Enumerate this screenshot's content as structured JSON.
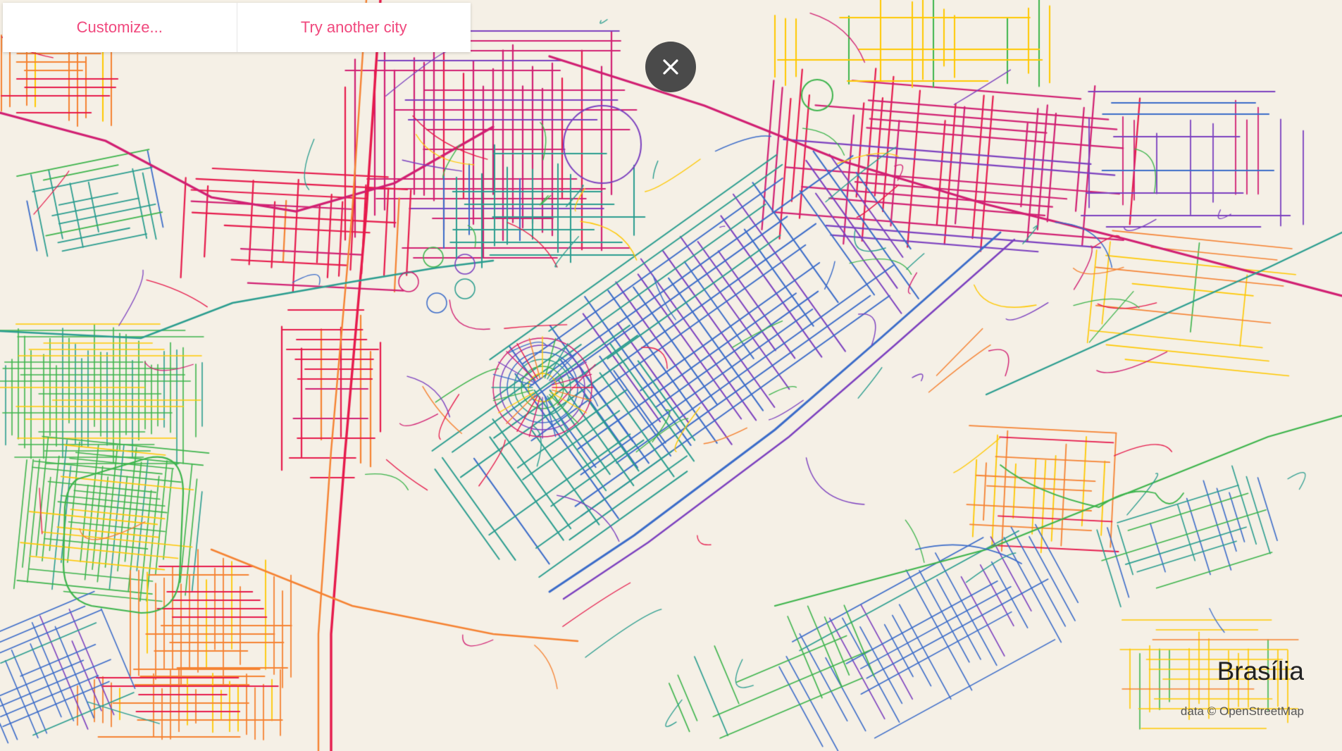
{
  "toolbar": {
    "customize_label": "Customize...",
    "another_city_label": "Try another city"
  },
  "close_button": {
    "icon": "close-icon"
  },
  "city": {
    "name": "Brasília"
  },
  "attribution": "data © OpenStreetMap",
  "colors": {
    "background": "#f5f0e6",
    "accent": "#f0487d",
    "close_button_bg": "#4a4a4a",
    "street_palette": [
      "#e6194b",
      "#f58231",
      "#ffc800",
      "#3cb44b",
      "#2a9d8f",
      "#3a6bc9",
      "#7b3fbf",
      "#d11f72"
    ]
  }
}
